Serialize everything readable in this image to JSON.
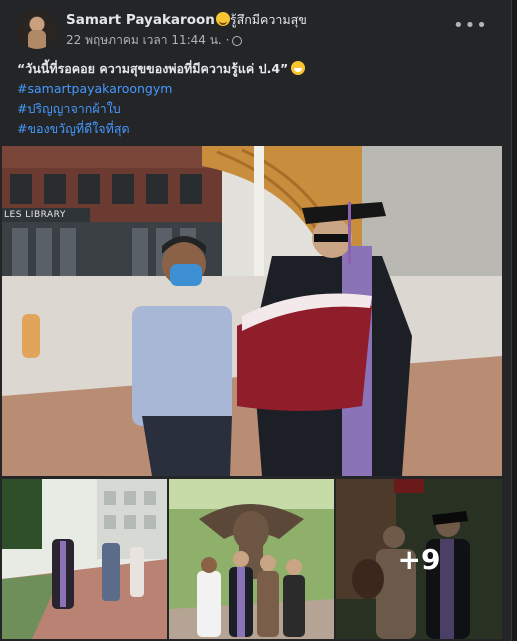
{
  "post": {
    "author": "Samart Payakaroon",
    "status": "รู้สึกมีความสุข",
    "timestamp": "22 พฤษภาคม เวลา 11:44 น.",
    "separator": "·",
    "more_options": "•••"
  },
  "caption": {
    "quote": "“วันนี้ที่รอคอย ความสุขของพ่อที่มีความรู้แค่ ป.4”",
    "hashtags": [
      "#samartpayakaroongym",
      "#ปริญญาจากผ้าใบ",
      "#ของขวัญที่ดีใจที่สุด"
    ]
  },
  "photos": {
    "main_sign": "LES LIBRARY",
    "more_count": "+9"
  },
  "colors": {
    "background": "#242526",
    "text": "#e4e6eb",
    "secondary": "#b0b3b8",
    "link": "#4599ff"
  }
}
